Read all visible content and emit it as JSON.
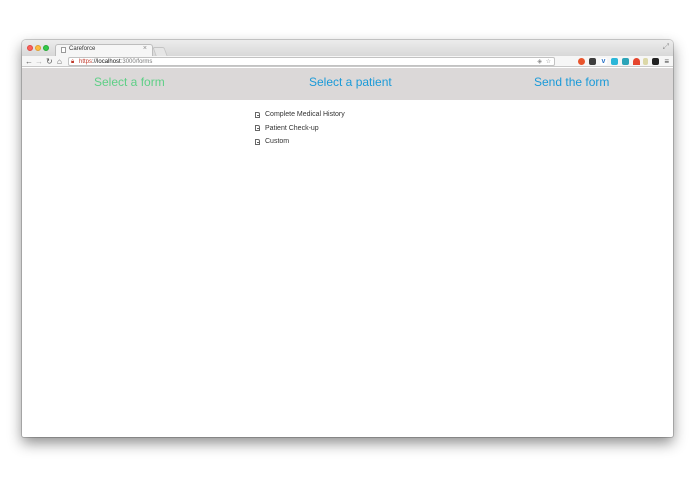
{
  "browser": {
    "tab_title": "Careforce",
    "tab_close": "×",
    "url": {
      "scheme": "https",
      "separator": "://",
      "host": "localhost",
      "path": ":3000/forms"
    },
    "icons": {
      "back": "back-arrow-icon",
      "forward": "forward-arrow-icon",
      "reload": "reload-icon",
      "home": "home-icon",
      "lock": "lock-icon",
      "menu": "hamburger-menu-icon"
    }
  },
  "steps": {
    "select_form": "Select a form",
    "select_patient": "Select a patient",
    "send_form": "Send the form",
    "colors": {
      "active": "#5ecf86",
      "inactive": "#1a9ad8"
    }
  },
  "forms": [
    {
      "label": "Complete Medical History"
    },
    {
      "label": "Patient Check-up"
    },
    {
      "label": "Custom"
    }
  ]
}
